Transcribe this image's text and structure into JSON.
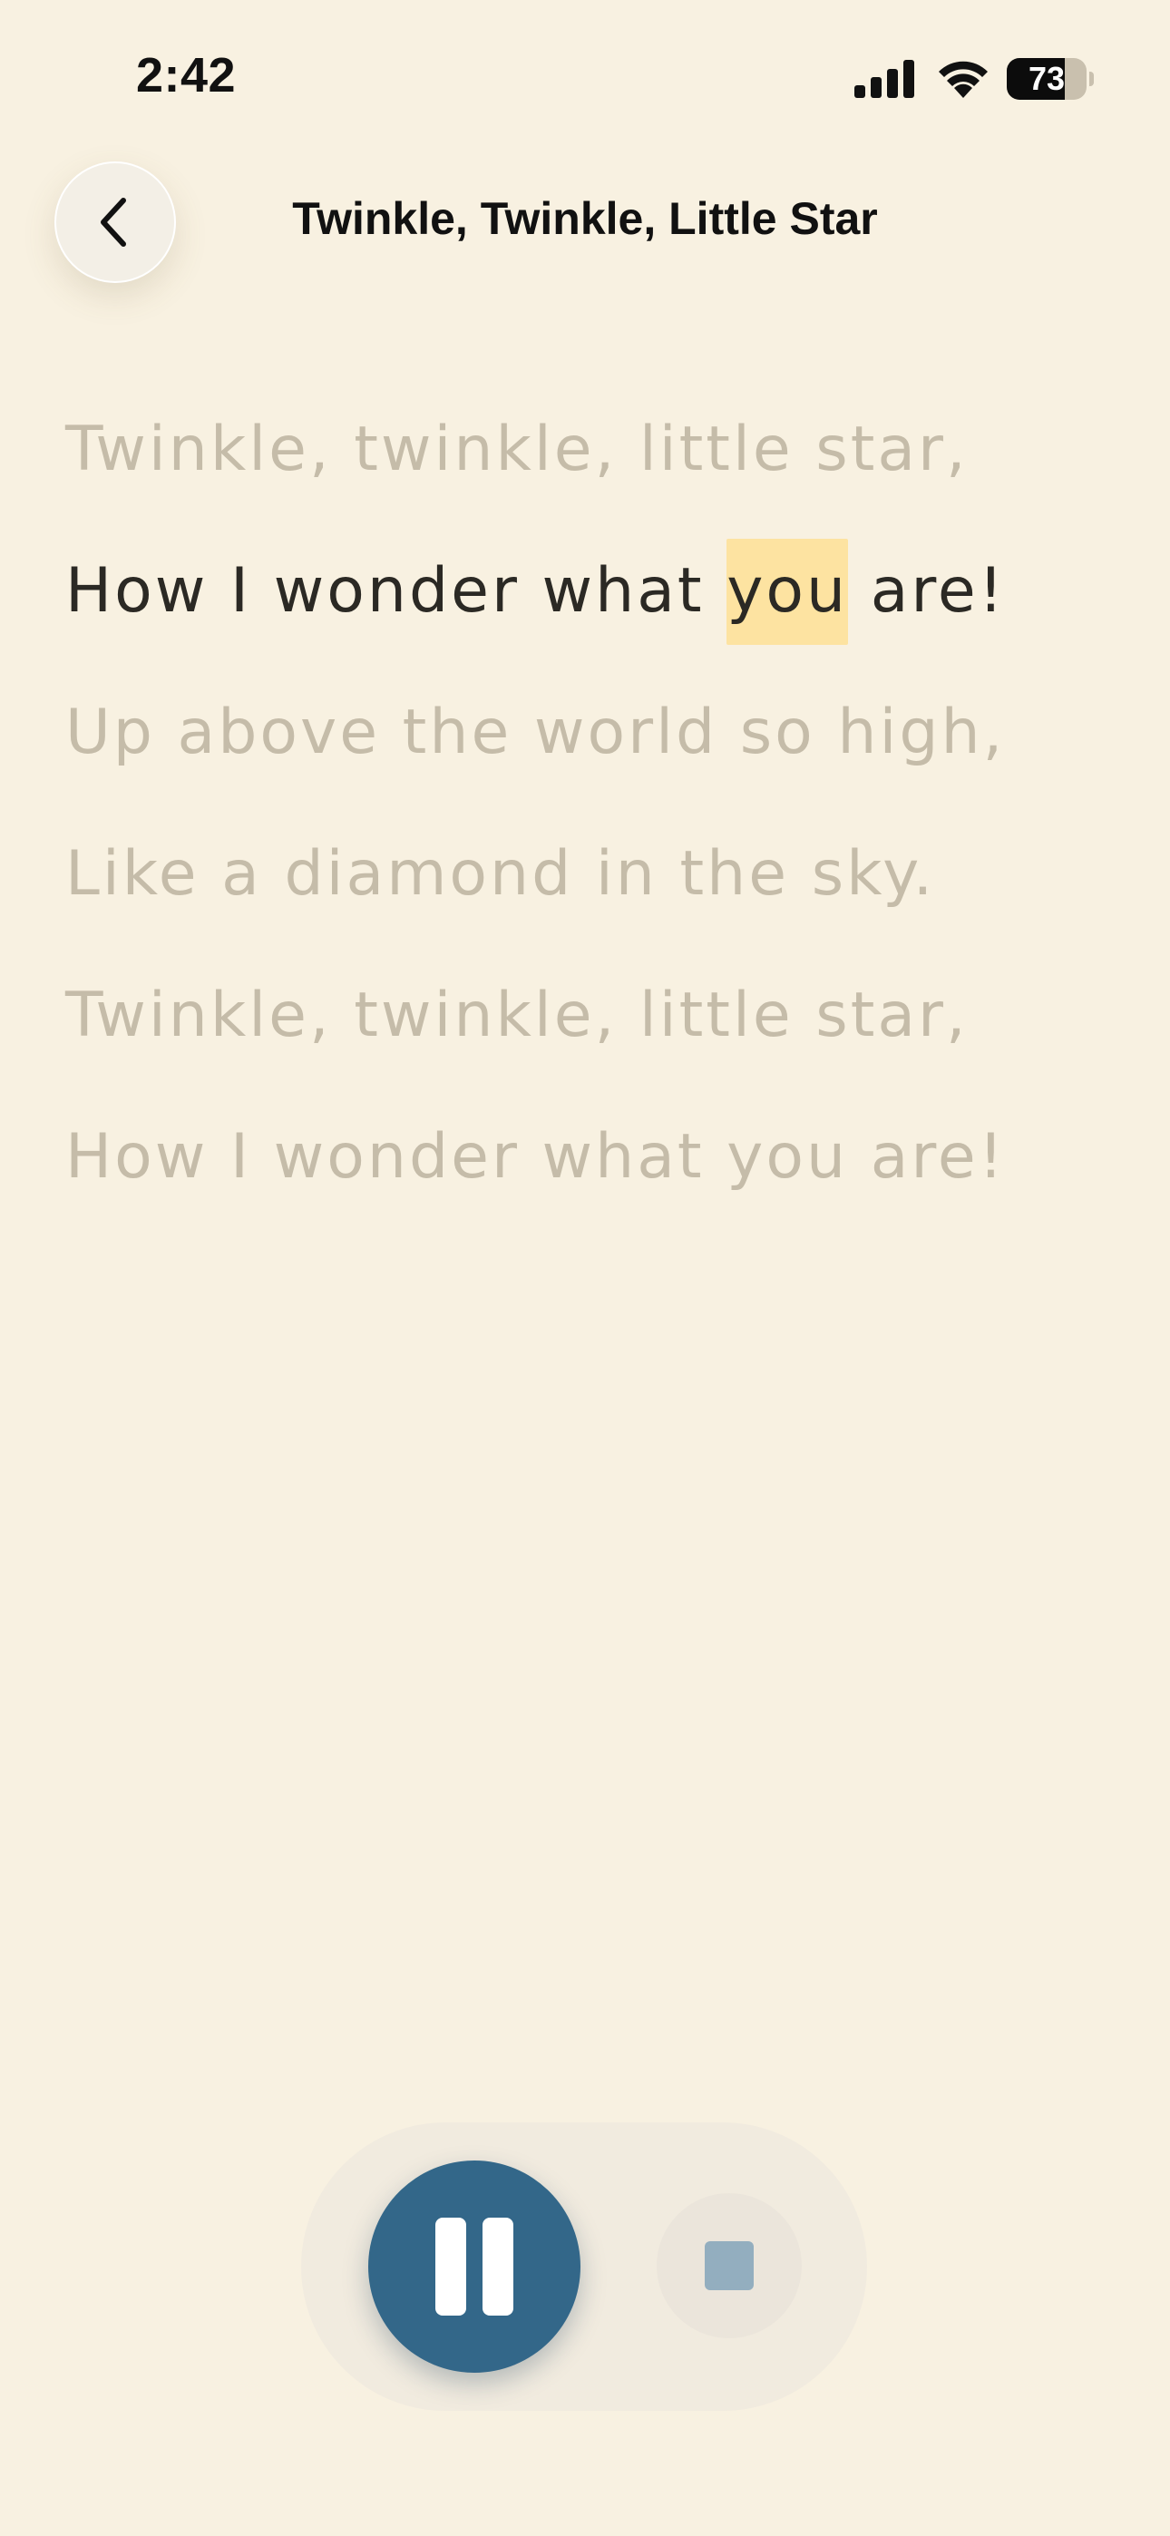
{
  "status_bar": {
    "time": "2:42",
    "battery_percent": 73,
    "battery_label": "73"
  },
  "header": {
    "back_icon": "chevron-left-icon",
    "title": "Twinkle, Twinkle, Little Star"
  },
  "lyrics": {
    "lines": [
      {
        "text": "Twinkle, twinkle, little star,"
      },
      {
        "before": "How I wonder what ",
        "highlight": "you",
        "after": " are!"
      },
      {
        "text": "Up above the world so high,"
      },
      {
        "text": "Like a diamond in the sky."
      },
      {
        "text": "Twinkle, twinkle, little star,"
      },
      {
        "text": "How I wonder what you are!"
      }
    ],
    "active_line_index": 1
  },
  "controls": {
    "pause_icon": "pause-icon",
    "stop_icon": "stop-icon"
  },
  "colors": {
    "background": "#f8f1e1",
    "active_text": "#2b2924",
    "inactive_text": "#c5bca9",
    "word_highlight": "#fde3a1",
    "pause_button": "#336789",
    "stop_icon": "#93aebf"
  }
}
